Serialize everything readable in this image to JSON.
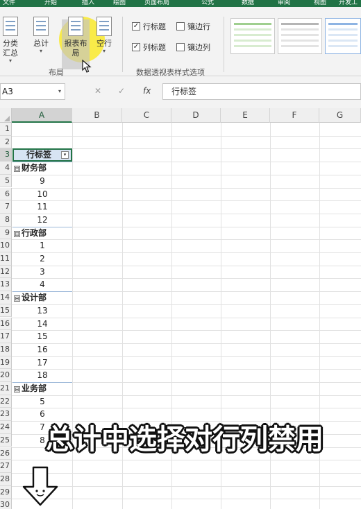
{
  "tabs": [
    "文件",
    "开始",
    "插入",
    "绘图",
    "页面布局",
    "公式",
    "数据",
    "审阅",
    "视图",
    "开发工"
  ],
  "ribbon": {
    "subtotal": "分类汇总",
    "grandtotal": "总计",
    "report_layout_l1": "报表布",
    "report_layout_l2": "局",
    "blank_rows": "空行",
    "layout_group": "布局",
    "row_headers": "行标题",
    "banded_rows": "镶边行",
    "col_headers": "列标题",
    "banded_cols": "镶边列",
    "style_options_group": "数据透视表样式选项",
    "check_mark": "✓",
    "caret": "▾"
  },
  "formula_bar": {
    "name_box": "A3",
    "cancel": "✕",
    "enter": "✓",
    "fx": "fx",
    "content": "行标签"
  },
  "grid": {
    "columns": [
      "A",
      "B",
      "C",
      "D",
      "E",
      "F",
      "G"
    ],
    "selected_column": "A",
    "rows": [
      "1",
      "2",
      "3",
      "4",
      "5",
      "6",
      "7",
      "8",
      "9",
      "10",
      "11",
      "12",
      "13",
      "14",
      "15",
      "16",
      "17",
      "18",
      "19",
      "20",
      "21",
      "22",
      "23",
      "24",
      "25",
      "26",
      "27",
      "28",
      "29",
      "30"
    ],
    "selected_row": "3"
  },
  "pivot": {
    "header": "行标签",
    "filter_icon": "▾",
    "expand_icon": "⊟",
    "groups": [
      {
        "dept": "财务部",
        "items": [
          "9",
          "10",
          "11",
          "12"
        ]
      },
      {
        "dept": "行政部",
        "items": [
          "1",
          "2",
          "3",
          "4"
        ]
      },
      {
        "dept": "设计部",
        "items": [
          "13",
          "14",
          "15",
          "16",
          "17",
          "18"
        ]
      },
      {
        "dept": "业务部",
        "items": [
          "5",
          "6",
          "7",
          "8"
        ]
      }
    ]
  },
  "caption": "总计中选择对行列禁用"
}
